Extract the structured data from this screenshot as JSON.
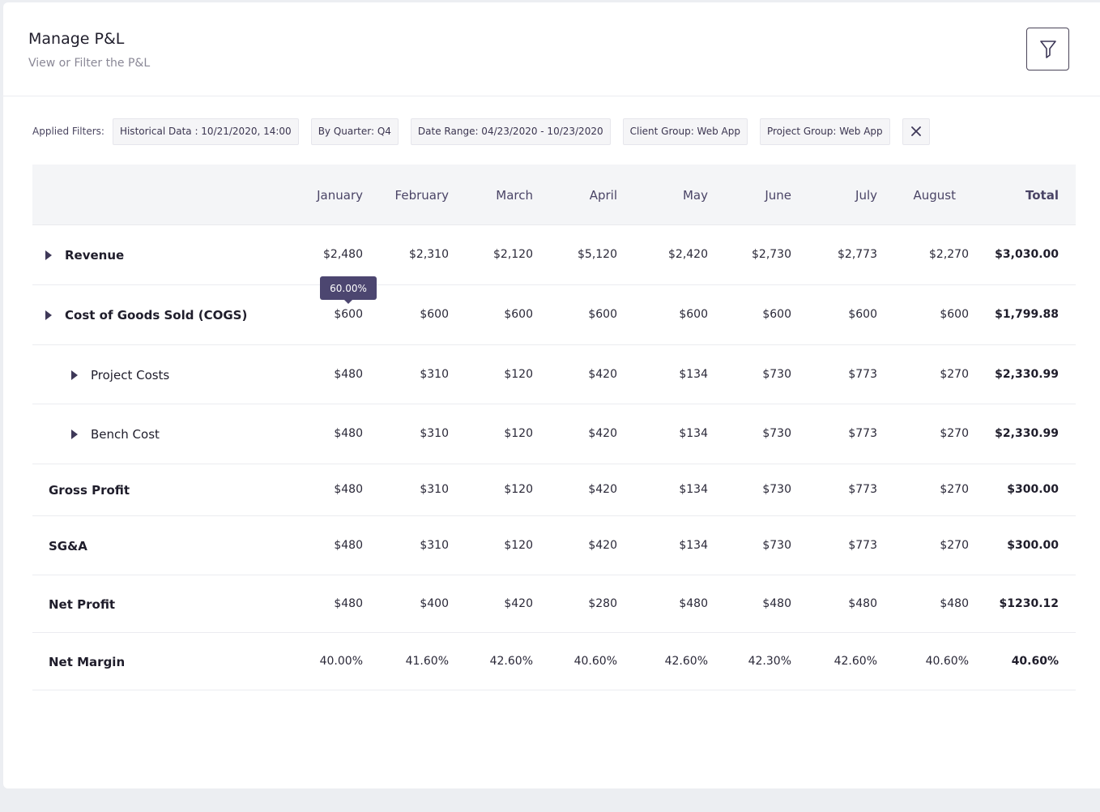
{
  "header": {
    "title": "Manage P&L",
    "subtitle": "View or Filter the P&L",
    "filter_icon": "filter-icon"
  },
  "filters": {
    "label": "Applied Filters:",
    "chips": [
      "Historical Data : 10/21/2020, 14:00",
      "By Quarter: Q4",
      "Date Range: 04/23/2020 - 10/23/2020",
      "Client Group: Web App",
      "Project Group: Web App"
    ],
    "clear_icon": "close-icon"
  },
  "table": {
    "columns": [
      "January",
      "February",
      "March",
      "April",
      "May",
      "June",
      "July",
      "August",
      "Total"
    ],
    "rows": [
      {
        "label": "Revenue",
        "expandable": true,
        "values": [
          "$2,480",
          "$2,310",
          "$2,120",
          "$5,120",
          "$2,420",
          "$2,730",
          "$2,773",
          "$2,270",
          "$3,030.00"
        ]
      },
      {
        "label": "Cost of Goods Sold (COGS)",
        "expandable": true,
        "values": [
          "$600",
          "$600",
          "$600",
          "$600",
          "$600",
          "$600",
          "$600",
          "$600",
          "$1,799.88"
        ]
      },
      {
        "label": "Project Costs",
        "expandable": true,
        "values": [
          "$480",
          "$310",
          "$120",
          "$420",
          "$134",
          "$730",
          "$773",
          "$270",
          "$2,330.99"
        ]
      },
      {
        "label": "Bench Cost",
        "expandable": true,
        "values": [
          "$480",
          "$310",
          "$120",
          "$420",
          "$134",
          "$730",
          "$773",
          "$270",
          "$2,330.99"
        ]
      },
      {
        "label": "Gross Profit",
        "expandable": false,
        "values": [
          "$480",
          "$310",
          "$120",
          "$420",
          "$134",
          "$730",
          "$773",
          "$270",
          "$300.00"
        ]
      },
      {
        "label": "SG&A",
        "expandable": false,
        "values": [
          "$480",
          "$310",
          "$120",
          "$420",
          "$134",
          "$730",
          "$773",
          "$270",
          "$300.00"
        ]
      },
      {
        "label": "Net Profit",
        "expandable": false,
        "values": [
          "$480",
          "$400",
          "$420",
          "$280",
          "$480",
          "$480",
          "$480",
          "$480",
          "$1230.12"
        ]
      },
      {
        "label": "Net Margin",
        "expandable": false,
        "values": [
          "40.00%",
          "41.60%",
          "42.60%",
          "40.60%",
          "42.60%",
          "42.30%",
          "42.60%",
          "40.60%",
          "40.60%"
        ]
      }
    ],
    "tooltip": "60.00%"
  }
}
